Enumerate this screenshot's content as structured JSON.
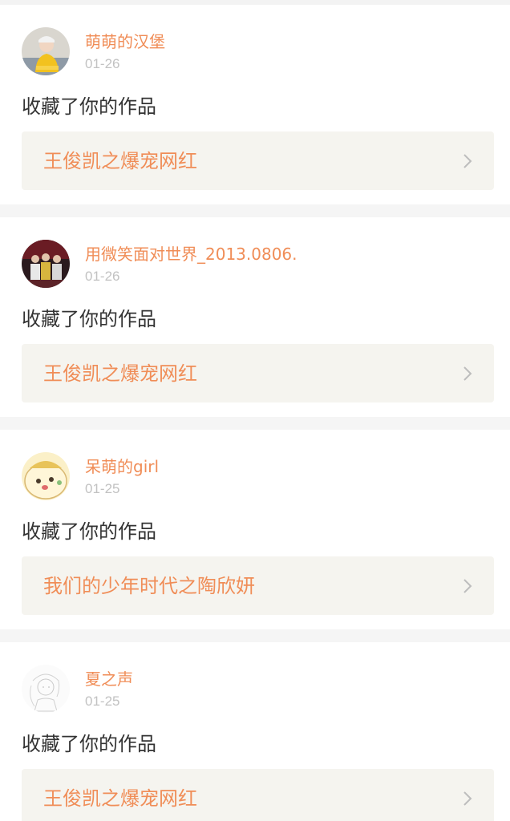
{
  "notifications": [
    {
      "username": "萌萌的汉堡",
      "date": "01-26",
      "action": "收藏了你的作品",
      "work_title": "王俊凯之爆宠网红",
      "avatar_icon": "user-photo-yellow-shirt"
    },
    {
      "username": "用微笑面对世界_2013.0806.",
      "date": "01-26",
      "action": "收藏了你的作品",
      "work_title": "王俊凯之爆宠网红",
      "avatar_icon": "group-photo-stage"
    },
    {
      "username": "呆萌的girl",
      "date": "01-25",
      "action": "收藏了你的作品",
      "work_title": "我们的少年时代之陶欣妍",
      "avatar_icon": "cartoon-bun-face"
    },
    {
      "username": "夏之声",
      "date": "01-25",
      "action": "收藏了你的作品",
      "work_title": "王俊凯之爆宠网红",
      "avatar_icon": "sketch-anime-girl"
    }
  ],
  "colors": {
    "accent": "#f08d57",
    "date": "#c2c2c2",
    "text": "#333333",
    "link_bg": "#f5f4ef"
  }
}
